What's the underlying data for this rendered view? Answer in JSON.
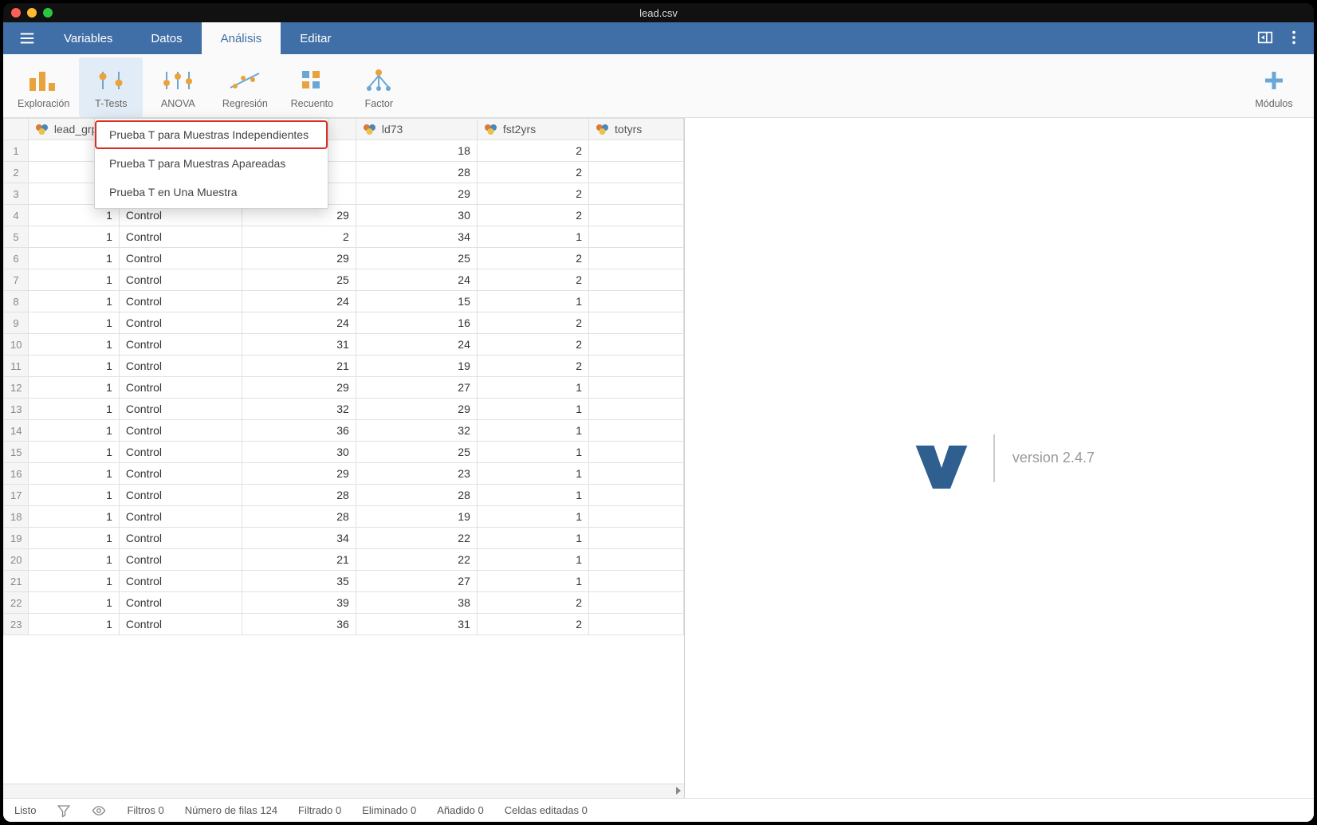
{
  "window_title": "lead.csv",
  "menu_tabs": {
    "variables": "Variables",
    "data": "Datos",
    "analysis": "Análisis",
    "edit": "Editar"
  },
  "ribbon": {
    "exploration": "Exploración",
    "ttests": "T-Tests",
    "anova": "ANOVA",
    "regression": "Regresión",
    "count": "Recuento",
    "factor": "Factor",
    "modules": "Módulos"
  },
  "dropdown": {
    "independent": "Prueba T para Muestras Independientes",
    "paired": "Prueba T para Muestras Apareadas",
    "one_sample": "Prueba T en Una Muestra"
  },
  "columns": {
    "lead_grp": "lead_grp",
    "group": "",
    "ld72": "",
    "ld73": "ld73",
    "fst2yrs": "fst2yrs",
    "totyrs": "totyrs"
  },
  "rows": [
    {
      "n": 1,
      "lead": "",
      "group": "",
      "ld72": "",
      "ld73": 18,
      "fst": 2,
      "tot": ""
    },
    {
      "n": 2,
      "lead": "",
      "group": "",
      "ld72": "",
      "ld73": 28,
      "fst": 2,
      "tot": ""
    },
    {
      "n": 3,
      "lead": "",
      "group": "",
      "ld72": "",
      "ld73": 29,
      "fst": 2,
      "tot": ""
    },
    {
      "n": 4,
      "lead": 1,
      "group": "Control",
      "ld72": 29,
      "ld73": 30,
      "fst": 2,
      "tot": ""
    },
    {
      "n": 5,
      "lead": 1,
      "group": "Control",
      "ld72": 2,
      "ld73": 34,
      "fst": 1,
      "tot": ""
    },
    {
      "n": 6,
      "lead": 1,
      "group": "Control",
      "ld72": 29,
      "ld73": 25,
      "fst": 2,
      "tot": ""
    },
    {
      "n": 7,
      "lead": 1,
      "group": "Control",
      "ld72": 25,
      "ld73": 24,
      "fst": 2,
      "tot": ""
    },
    {
      "n": 8,
      "lead": 1,
      "group": "Control",
      "ld72": 24,
      "ld73": 15,
      "fst": 1,
      "tot": ""
    },
    {
      "n": 9,
      "lead": 1,
      "group": "Control",
      "ld72": 24,
      "ld73": 16,
      "fst": 2,
      "tot": ""
    },
    {
      "n": 10,
      "lead": 1,
      "group": "Control",
      "ld72": 31,
      "ld73": 24,
      "fst": 2,
      "tot": ""
    },
    {
      "n": 11,
      "lead": 1,
      "group": "Control",
      "ld72": 21,
      "ld73": 19,
      "fst": 2,
      "tot": ""
    },
    {
      "n": 12,
      "lead": 1,
      "group": "Control",
      "ld72": 29,
      "ld73": 27,
      "fst": 1,
      "tot": ""
    },
    {
      "n": 13,
      "lead": 1,
      "group": "Control",
      "ld72": 32,
      "ld73": 29,
      "fst": 1,
      "tot": ""
    },
    {
      "n": 14,
      "lead": 1,
      "group": "Control",
      "ld72": 36,
      "ld73": 32,
      "fst": 1,
      "tot": ""
    },
    {
      "n": 15,
      "lead": 1,
      "group": "Control",
      "ld72": 30,
      "ld73": 25,
      "fst": 1,
      "tot": ""
    },
    {
      "n": 16,
      "lead": 1,
      "group": "Control",
      "ld72": 29,
      "ld73": 23,
      "fst": 1,
      "tot": ""
    },
    {
      "n": 17,
      "lead": 1,
      "group": "Control",
      "ld72": 28,
      "ld73": 28,
      "fst": 1,
      "tot": ""
    },
    {
      "n": 18,
      "lead": 1,
      "group": "Control",
      "ld72": 28,
      "ld73": 19,
      "fst": 1,
      "tot": ""
    },
    {
      "n": 19,
      "lead": 1,
      "group": "Control",
      "ld72": 34,
      "ld73": 22,
      "fst": 1,
      "tot": ""
    },
    {
      "n": 20,
      "lead": 1,
      "group": "Control",
      "ld72": 21,
      "ld73": 22,
      "fst": 1,
      "tot": ""
    },
    {
      "n": 21,
      "lead": 1,
      "group": "Control",
      "ld72": 35,
      "ld73": 27,
      "fst": 1,
      "tot": ""
    },
    {
      "n": 22,
      "lead": 1,
      "group": "Control",
      "ld72": 39,
      "ld73": 38,
      "fst": 2,
      "tot": ""
    },
    {
      "n": 23,
      "lead": 1,
      "group": "Control",
      "ld72": 36,
      "ld73": 31,
      "fst": 2,
      "tot": ""
    }
  ],
  "status": {
    "ready": "Listo",
    "filters": "Filtros 0",
    "rows": "Número de filas 124",
    "filtered": "Filtrado 0",
    "deleted": "Eliminado 0",
    "added": "Añadido 0",
    "edited": "Celdas editadas 0"
  },
  "version_label": "version 2.4.7"
}
